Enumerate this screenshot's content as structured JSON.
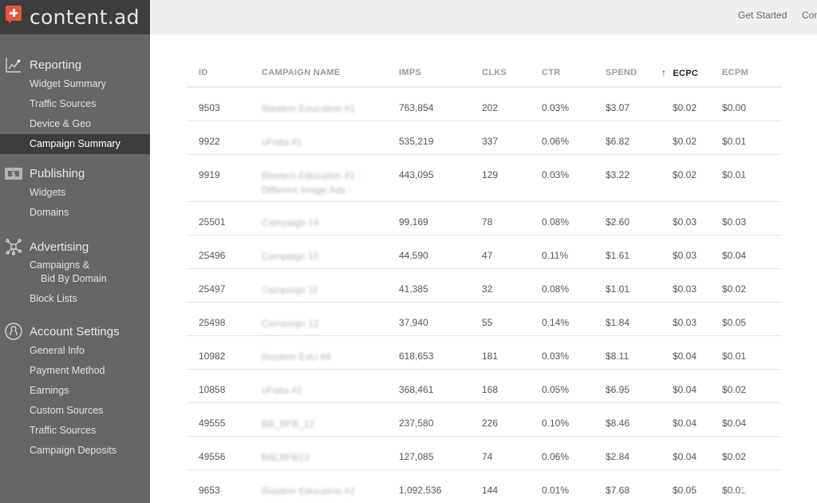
{
  "brand": {
    "name": "content.ad",
    "accent": "#e8553a"
  },
  "topbar": {
    "links": [
      "Get Started",
      "Con"
    ]
  },
  "sidebar": {
    "sections": [
      {
        "title": "Reporting",
        "icon": "chart-line-icon",
        "items": [
          "Widget Summary",
          "Traffic Sources",
          "Device & Geo",
          "Campaign Summary"
        ]
      },
      {
        "title": "Publishing",
        "icon": "dollar-bill-icon",
        "items": [
          "Widgets",
          "Domains"
        ]
      },
      {
        "title": "Advertising",
        "icon": "network-icon",
        "items": [
          "Campaigns &",
          "Bid By Domain",
          "Block Lists"
        ]
      },
      {
        "title": "Account Settings",
        "icon": "user-circle-icon",
        "items": [
          "General Info",
          "Payment Method",
          "Earnings",
          "Custom Sources",
          "Traffic Sources",
          "Campaign Deposits"
        ]
      }
    ],
    "active_item": "Campaign Summary"
  },
  "table": {
    "columns": [
      "ID",
      "CAMPAIGN NAME",
      "IMPS",
      "CLKS",
      "CTR",
      "SPEND",
      "ECPC",
      "ECPM"
    ],
    "sorted_column": "ECPC",
    "sort_arrow": "↑",
    "rows": [
      {
        "id": "9503",
        "name": "Blastem Education #1",
        "imps": "763,854",
        "clks": "202",
        "ctr": "0.03%",
        "spend": "$3.07",
        "ecpc": "$0.02",
        "ecpm": "$0.00"
      },
      {
        "id": "9922",
        "name": "uFotta #1",
        "imps": "535,219",
        "clks": "337",
        "ctr": "0.06%",
        "spend": "$6.82",
        "ecpc": "$0.02",
        "ecpm": "$0.01"
      },
      {
        "id": "9919",
        "name": "Blastem Education #1 - Different Image Ads -",
        "imps": "443,095",
        "clks": "129",
        "ctr": "0.03%",
        "spend": "$3.22",
        "ecpc": "$0.02",
        "ecpm": "$0.01"
      },
      {
        "id": "25501",
        "name": "Campaign 14",
        "imps": "99,169",
        "clks": "78",
        "ctr": "0.08%",
        "spend": "$2.60",
        "ecpc": "$0.03",
        "ecpm": "$0.03"
      },
      {
        "id": "25496",
        "name": "Campaign 10",
        "imps": "44,590",
        "clks": "47",
        "ctr": "0.11%",
        "spend": "$1.61",
        "ecpc": "$0.03",
        "ecpm": "$0.04"
      },
      {
        "id": "25497",
        "name": "Campaign 11",
        "imps": "41,385",
        "clks": "32",
        "ctr": "0.08%",
        "spend": "$1.01",
        "ecpc": "$0.03",
        "ecpm": "$0.02"
      },
      {
        "id": "25498",
        "name": "Campaign 12",
        "imps": "37,940",
        "clks": "55",
        "ctr": "0.14%",
        "spend": "$1.84",
        "ecpc": "$0.03",
        "ecpm": "$0.05"
      },
      {
        "id": "10982",
        "name": "Blastem EdU #4",
        "imps": "618,653",
        "clks": "181",
        "ctr": "0.03%",
        "spend": "$8.11",
        "ecpc": "$0.04",
        "ecpm": "$0.01"
      },
      {
        "id": "10858",
        "name": "uFotta #2",
        "imps": "368,461",
        "clks": "168",
        "ctr": "0.05%",
        "spend": "$6.95",
        "ecpc": "$0.04",
        "ecpm": "$0.02"
      },
      {
        "id": "49555",
        "name": "BB_BFB_12",
        "imps": "237,580",
        "clks": "226",
        "ctr": "0.10%",
        "spend": "$8.46",
        "ecpc": "$0.04",
        "ecpm": "$0.04"
      },
      {
        "id": "49556",
        "name": "BBLBFB13",
        "imps": "127,085",
        "clks": "74",
        "ctr": "0.06%",
        "spend": "$2.84",
        "ecpc": "$0.04",
        "ecpm": "$0.02"
      },
      {
        "id": "9653",
        "name": "Blastem Education #2",
        "imps": "1,092,536",
        "clks": "144",
        "ctr": "0.01%",
        "spend": "$7.68",
        "ecpc": "$0.05",
        "ecpm": "$0.01"
      }
    ]
  }
}
